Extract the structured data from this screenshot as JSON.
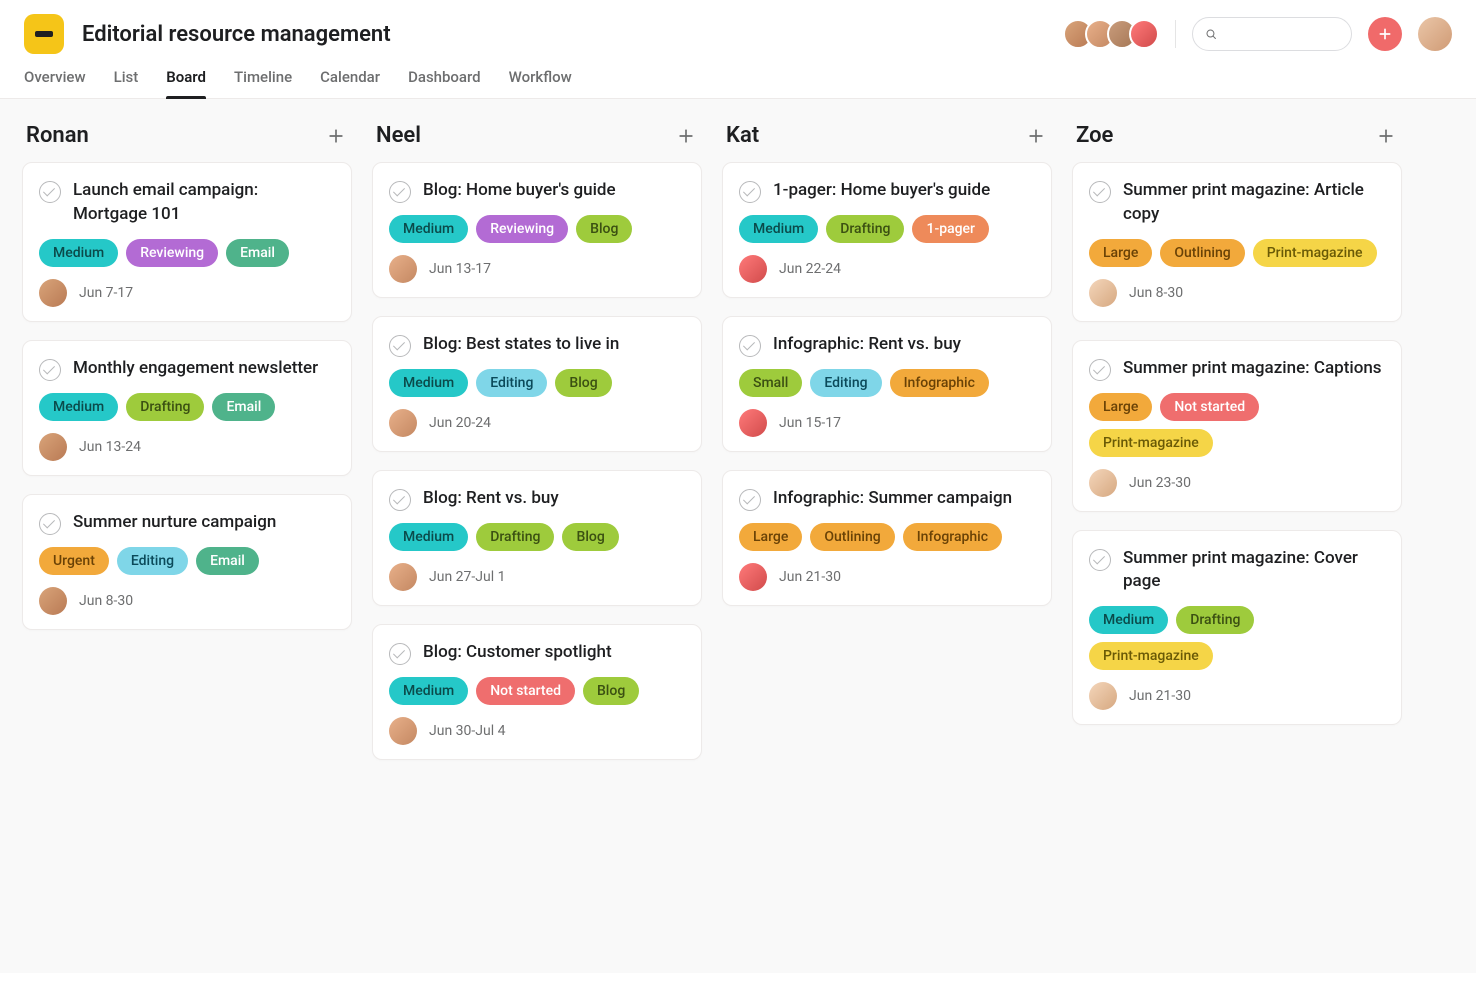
{
  "project": {
    "title": "Editorial resource management"
  },
  "search": {
    "placeholder": ""
  },
  "tabs": [
    {
      "label": "Overview",
      "active": false
    },
    {
      "label": "List",
      "active": false
    },
    {
      "label": "Board",
      "active": true
    },
    {
      "label": "Timeline",
      "active": false
    },
    {
      "label": "Calendar",
      "active": false
    },
    {
      "label": "Dashboard",
      "active": false
    },
    {
      "label": "Workflow",
      "active": false
    }
  ],
  "tag_styles": {
    "Medium": "tag-medium",
    "Small": "tag-small",
    "Large": "tag-large",
    "Urgent": "tag-urgent",
    "Reviewing": "tag-reviewing",
    "Drafting": "tag-drafting",
    "Editing": "tag-editing",
    "Outlining": "tag-outlining",
    "Not started": "tag-notstarted",
    "Email": "tag-email",
    "Blog": "tag-blog",
    "1-pager": "tag-1pager",
    "Infographic": "tag-infographic",
    "Print-magazine": "tag-printmag"
  },
  "avatar_classes": {
    "ronan": "av-a",
    "neel": "av-b",
    "kat": "av-d",
    "zoe": "av-f",
    "header1": "av-a",
    "header2": "av-b",
    "header3": "av-c",
    "header4": "av-d",
    "profile": "av-e"
  },
  "columns": [
    {
      "name": "Ronan",
      "cards": [
        {
          "title": "Launch email campaign: Mortgage 101",
          "tags": [
            "Medium",
            "Reviewing",
            "Email"
          ],
          "assignee": "ronan",
          "date": "Jun 7-17"
        },
        {
          "title": "Monthly engagement newsletter",
          "tags": [
            "Medium",
            "Drafting",
            "Email"
          ],
          "assignee": "ronan",
          "date": "Jun 13-24"
        },
        {
          "title": "Summer nurture campaign",
          "tags": [
            "Urgent",
            "Editing",
            "Email"
          ],
          "assignee": "ronan",
          "date": "Jun 8-30"
        }
      ]
    },
    {
      "name": "Neel",
      "cards": [
        {
          "title": "Blog: Home buyer's guide",
          "tags": [
            "Medium",
            "Reviewing",
            "Blog"
          ],
          "assignee": "neel",
          "date": "Jun 13-17"
        },
        {
          "title": "Blog: Best states to live in",
          "tags": [
            "Medium",
            "Editing",
            "Blog"
          ],
          "assignee": "neel",
          "date": "Jun 20-24"
        },
        {
          "title": "Blog: Rent vs. buy",
          "tags": [
            "Medium",
            "Drafting",
            "Blog"
          ],
          "assignee": "neel",
          "date": "Jun 27-Jul 1"
        },
        {
          "title": "Blog: Customer spotlight",
          "tags": [
            "Medium",
            "Not started",
            "Blog"
          ],
          "assignee": "neel",
          "date": "Jun 30-Jul 4"
        }
      ]
    },
    {
      "name": "Kat",
      "cards": [
        {
          "title": "1-pager: Home buyer's guide",
          "tags": [
            "Medium",
            "Drafting",
            "1-pager"
          ],
          "assignee": "kat",
          "date": "Jun 22-24"
        },
        {
          "title": "Infographic: Rent vs. buy",
          "tags": [
            "Small",
            "Editing",
            "Infographic"
          ],
          "assignee": "kat",
          "date": "Jun 15-17"
        },
        {
          "title": "Infographic: Summer campaign",
          "tags": [
            "Large",
            "Outlining",
            "Infographic"
          ],
          "assignee": "kat",
          "date": "Jun 21-30"
        }
      ]
    },
    {
      "name": "Zoe",
      "cards": [
        {
          "title": "Summer print magazine: Article copy",
          "tags": [
            "Large",
            "Outlining",
            "Print-magazine"
          ],
          "assignee": "zoe",
          "date": "Jun 8-30"
        },
        {
          "title": "Summer print magazine: Captions",
          "tags": [
            "Large",
            "Not started",
            "Print-magazine"
          ],
          "assignee": "zoe",
          "date": "Jun 23-30"
        },
        {
          "title": "Summer print magazine: Cover page",
          "tags": [
            "Medium",
            "Drafting",
            "Print-magazine"
          ],
          "assignee": "zoe",
          "date": "Jun 21-30"
        }
      ]
    }
  ]
}
